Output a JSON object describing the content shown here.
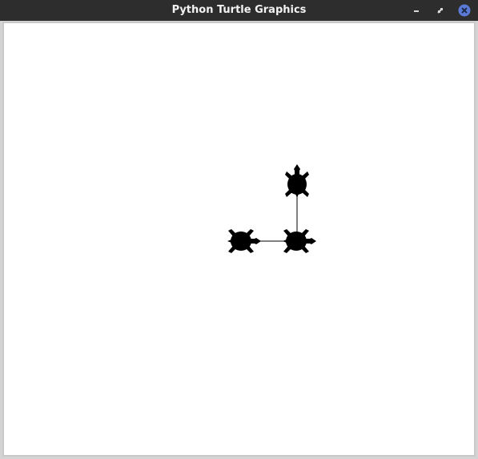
{
  "window": {
    "title": "Python Turtle Graphics"
  },
  "titlebar_buttons": {
    "minimize_icon": "minimize-icon",
    "maximize_icon": "restore-icon",
    "close_icon": "close-icon",
    "close_color": "#5b79d6"
  },
  "canvas": {
    "background": "#ffffff",
    "pen_color": "#000000",
    "turtle_color": "#000000"
  }
}
